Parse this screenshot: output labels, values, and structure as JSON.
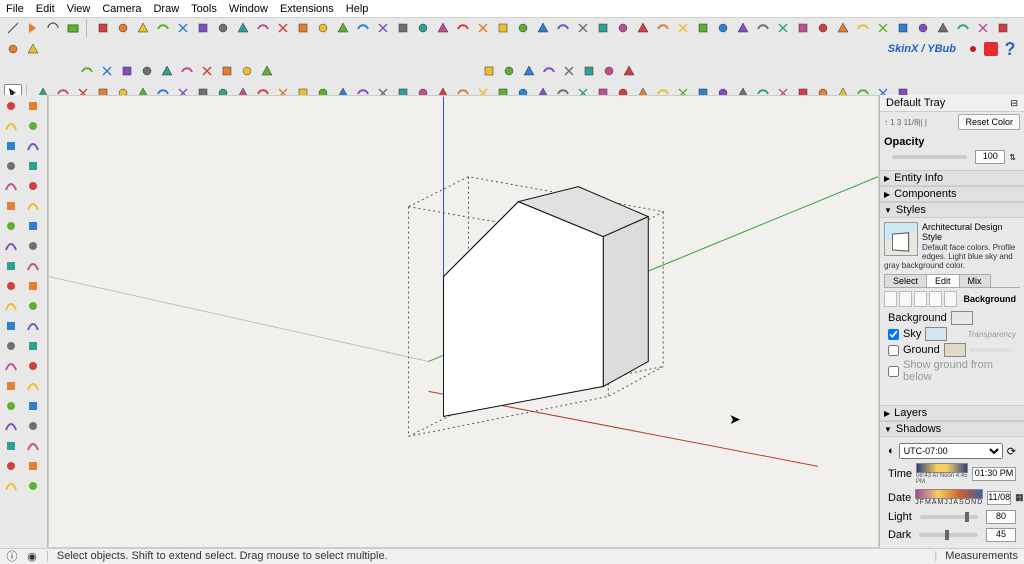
{
  "menu": [
    "File",
    "Edit",
    "View",
    "Camera",
    "Draw",
    "Tools",
    "Window",
    "Extensions",
    "Help"
  ],
  "brand": {
    "text": "SkinX / YBub"
  },
  "tray": {
    "title": "Default Tray",
    "coords_hint": "↑  1 3 11/8|| |",
    "reset_btn": "Reset Color",
    "opacity_label": "Opacity",
    "opacity_value": "100",
    "panels": {
      "entity_info": "Entity Info",
      "components": "Components",
      "styles": "Styles",
      "layers": "Layers",
      "shadows": "Shadows"
    },
    "styles": {
      "name": "Architectural Design Style",
      "desc": "Default face colors. Profile edges. Light blue sky and gray background color.",
      "tabs": {
        "select": "Select",
        "edit": "Edit",
        "mix": "Mix"
      },
      "section_background": "Background",
      "label_background": "Background",
      "label_sky": "Sky",
      "label_ground": "Ground",
      "transparency": "Transparency",
      "show_ground": "Show ground from below",
      "sky_checked": true,
      "ground_checked": false,
      "show_ground_checked": false
    },
    "shadows": {
      "tz": "UTC-07:00",
      "time_label": "Time",
      "time_marks": "08:43 AI  Noon  4:45 PM",
      "time_value": "01:30 PM",
      "date_label": "Date",
      "month_letters": "JFMAMJJASOND",
      "date_value": "11/08",
      "light_label": "Light",
      "light_value": "80",
      "dark_label": "Dark",
      "dark_value": "45"
    }
  },
  "status": {
    "hint": "Select objects. Shift to extend select. Drag mouse to select multiple.",
    "measurements_label": "Measurements"
  }
}
